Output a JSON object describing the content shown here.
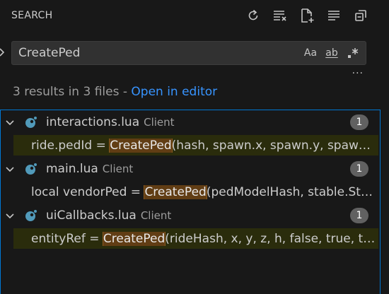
{
  "header": {
    "title": "SEARCH",
    "actions": [
      "refresh-icon",
      "clear-results-icon",
      "new-search-editor-icon",
      "view-as-tree-icon",
      "collapse-all-icon"
    ]
  },
  "search": {
    "value": "CreatePed",
    "toggles": {
      "match_case": "Aa",
      "whole_word": "ab",
      "regex": ".*"
    },
    "more": "···"
  },
  "summary": {
    "text": "3 results in 3 files - ",
    "link": "Open in editor"
  },
  "results": [
    {
      "file": "interactions.lua",
      "desc": "Client",
      "count": "1",
      "highlighted": true,
      "line": {
        "before": "ride.pedId = ",
        "match": "CreatePed",
        "after": "(hash, spawn.x, spawn.y, spawn.z..."
      }
    },
    {
      "file": "main.lua",
      "desc": "Client",
      "count": "1",
      "highlighted": false,
      "line": {
        "before": "local vendorPed = ",
        "match": "CreatePed",
        "after": "(pedModelHash, stable.Sta..."
      }
    },
    {
      "file": "uiCallbacks.lua",
      "desc": "Client",
      "count": "1",
      "highlighted": true,
      "line": {
        "before": "entityRef = ",
        "match": "CreatePed",
        "after": "(rideHash, x, y, z, h, false, true, tru..."
      }
    }
  ],
  "colors": {
    "background": "#181818",
    "link": "#3794ff",
    "match_highlight": "#613d14",
    "focus_border": "#0078d4",
    "lua_icon": "#519aba"
  }
}
